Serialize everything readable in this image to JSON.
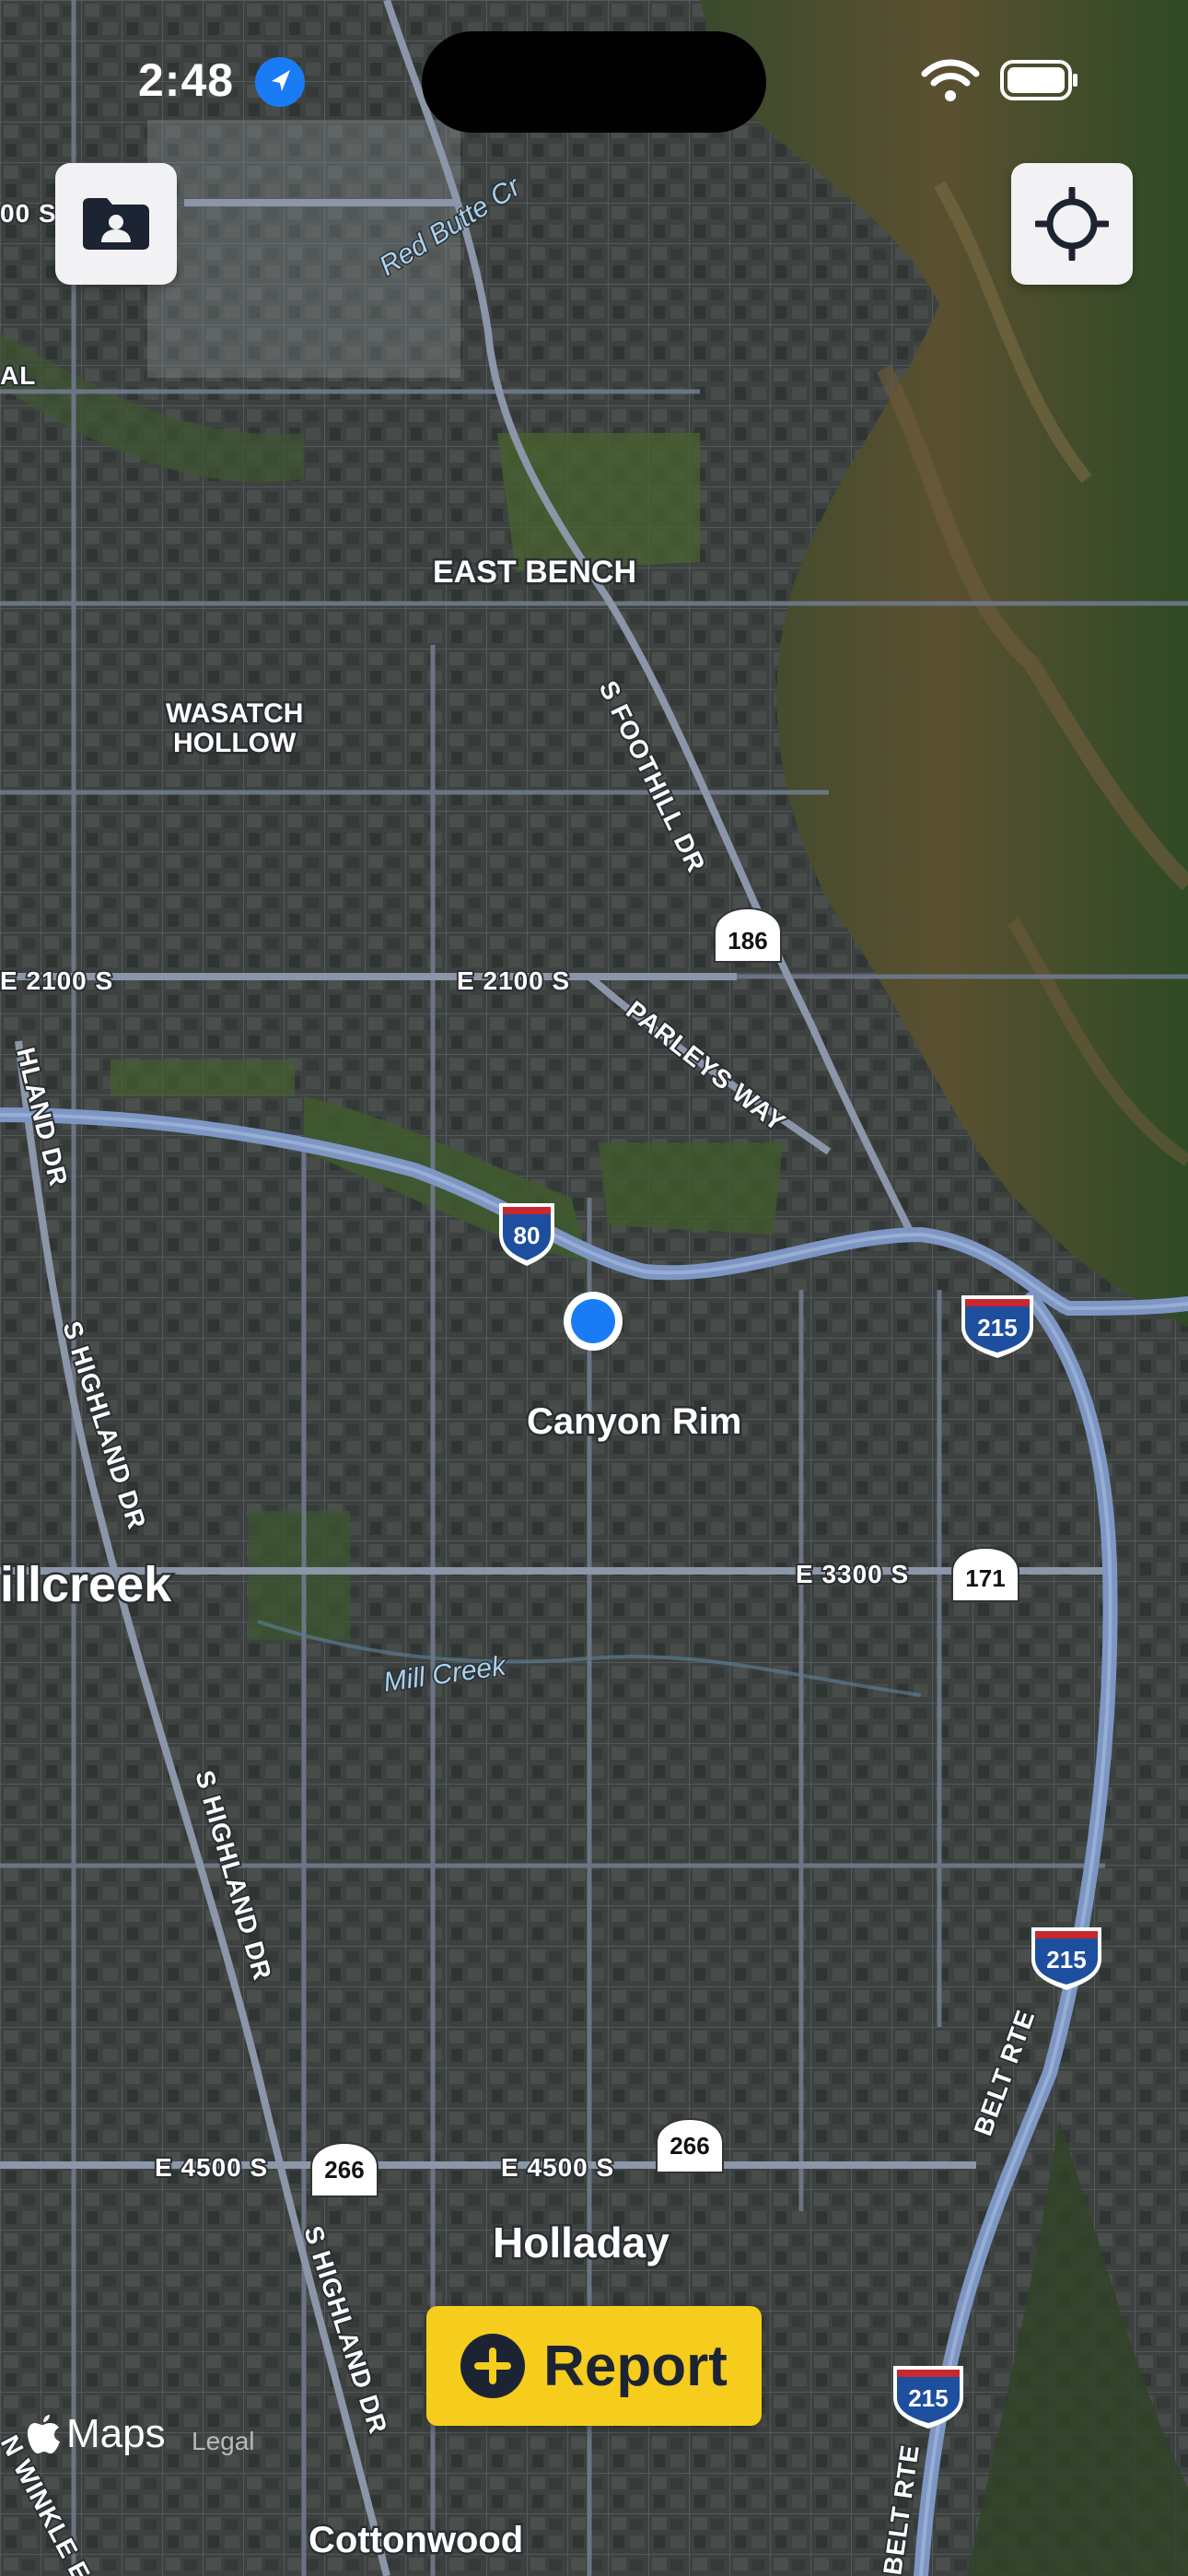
{
  "status_bar": {
    "time": "2:48"
  },
  "map": {
    "type": "satellite",
    "neighborhoods": {
      "east_bench": "EAST BENCH",
      "wasatch_hollow_line1": "WASATCH",
      "wasatch_hollow_line2": "HOLLOW",
      "canyon_rim": "Canyon Rim",
      "millcreek": "illcreek",
      "holladay": "Holladay",
      "cottonwood": "Cottonwood"
    },
    "roads": {
      "foothill": "S FOOTHILL DR",
      "e2100_left": "E 2100 S",
      "e2100_mid": "E 2100 S",
      "parleys": "PARLEYS WAY",
      "highland_upper": "S HIGHLAND DR",
      "highland_mid": "S HIGHLAND DR",
      "highland_lower": "S HIGHLAND DR",
      "highland_top_left": "HLAND DR",
      "e3300": "E 3300 S",
      "e4500_left": "E 4500 S",
      "e4500_mid": "E 4500 S",
      "belt_rte_upper": "BELT RTE",
      "belt_rte_lower": "BELT RTE",
      "red_butte": "Red Butte Cr",
      "winkle": "N WINKLE E",
      "top_left_1": "00 S",
      "top_left_2": "AL"
    },
    "waterways": {
      "mill_creek": "Mill Creek"
    },
    "shields": {
      "i80": "80",
      "i215_a": "215",
      "i215_b": "215",
      "i215_c": "215",
      "sr186": "186",
      "sr171": "171",
      "sr266_a": "266",
      "sr266_b": "266"
    }
  },
  "buttons": {
    "contacts_icon": "person-folder-icon",
    "locate_icon": "crosshair-icon",
    "report": "Report"
  },
  "attribution": {
    "maps": "Maps",
    "legal": "Legal"
  },
  "colors": {
    "report_bg": "#f6cd1c",
    "report_text": "#1c2433",
    "user_location": "#1a7cf5",
    "highway": "#7d96c4"
  }
}
